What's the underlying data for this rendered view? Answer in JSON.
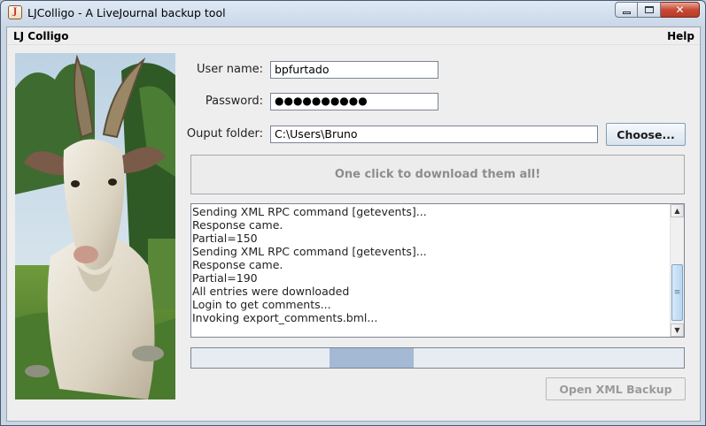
{
  "window": {
    "title": "LJColligo - A LiveJournal backup tool",
    "icon": "java-cup-icon",
    "controls": {
      "minimize": "▭",
      "maximize": "☐",
      "close": "✕"
    }
  },
  "menubar": {
    "left": "LJ Colligo",
    "right": "Help"
  },
  "form": {
    "username_label": "User name:",
    "username_value": "bpfurtado",
    "password_label": "Password:",
    "password_value": "●●●●●●●●●●",
    "folder_label": "Ouput folder:",
    "folder_value": "C:\\Users\\Bruno",
    "choose_button": "Choose..."
  },
  "download_button": "One click to download them all!",
  "log": {
    "lines": [
      "Sending XML RPC command [getevents]...",
      "Response came.",
      "Partial=150",
      "Sending XML RPC command [getevents]...",
      "Response came.",
      "Partial=190",
      "All entries were downloaded",
      "Login to get comments...",
      "Invoking export_comments.bml..."
    ]
  },
  "progress": {
    "indeterminate_segment_start": 0.28,
    "indeterminate_segment_width": 0.17
  },
  "open_button": "Open XML Backup",
  "colors": {
    "progress_fill": "#a4b9d4",
    "titlebar": "#c8d6e6"
  }
}
